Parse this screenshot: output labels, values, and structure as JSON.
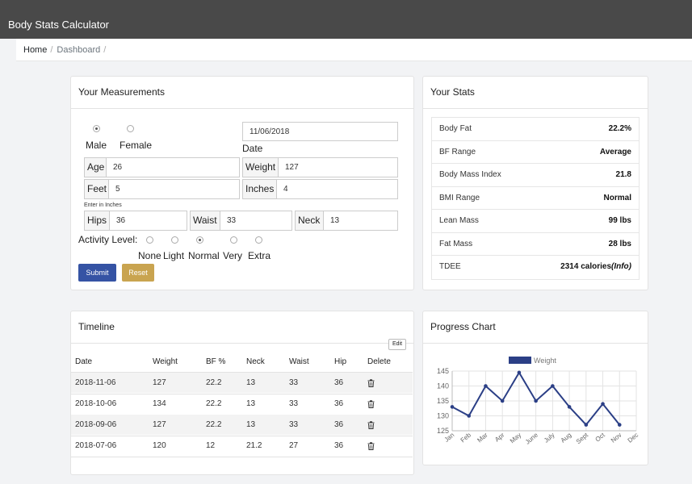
{
  "app": {
    "title": "Body Stats Calculator"
  },
  "breadcrumb": {
    "home": "Home",
    "current": "Dashboard"
  },
  "measurements": {
    "title": "Your Measurements",
    "sex": {
      "male_label": "Male",
      "female_label": "Female",
      "selected": "Male"
    },
    "date": {
      "value": "11/06/2018",
      "label": "Date"
    },
    "age": {
      "label": "Age",
      "value": "26"
    },
    "weight": {
      "label": "Weight",
      "value": "127"
    },
    "feet": {
      "label": "Feet",
      "value": "5"
    },
    "inches": {
      "label": "Inches",
      "value": "4"
    },
    "note": "Enter in Inches",
    "hips": {
      "label": "Hips",
      "value": "36"
    },
    "waist": {
      "label": "Waist",
      "value": "33"
    },
    "neck": {
      "label": "Neck",
      "value": "13"
    },
    "activity": {
      "label": "Activity Level:",
      "options": [
        "None",
        "Light",
        "Normal",
        "Very",
        "Extra"
      ],
      "selected": "Normal"
    },
    "submit_label": "Submit",
    "reset_label": "Reset"
  },
  "stats": {
    "title": "Your Stats",
    "rows": [
      {
        "key": "Body Fat",
        "value": "22.2%"
      },
      {
        "key": "BF Range",
        "value": "Average"
      },
      {
        "key": "Body Mass Index",
        "value": "21.8"
      },
      {
        "key": "BMI Range",
        "value": "Normal"
      },
      {
        "key": "Lean Mass",
        "value": "99 lbs"
      },
      {
        "key": "Fat Mass",
        "value": "28 lbs"
      },
      {
        "key": "TDEE",
        "value": "2314 calories",
        "info": "(Info)"
      }
    ]
  },
  "timeline": {
    "title": "Timeline",
    "edit_label": "Edit",
    "columns": [
      "Date",
      "Weight",
      "BF %",
      "Neck",
      "Waist",
      "Hip",
      "Delete"
    ],
    "rows": [
      [
        "2018-11-06",
        "127",
        "22.2",
        "13",
        "33",
        "36"
      ],
      [
        "2018-10-06",
        "134",
        "22.2",
        "13",
        "33",
        "36"
      ],
      [
        "2018-09-06",
        "127",
        "22.2",
        "13",
        "33",
        "36"
      ],
      [
        "2018-07-06",
        "120",
        "12",
        "21.2",
        "27",
        "36"
      ]
    ],
    "delete_icon": "trash-icon"
  },
  "progress": {
    "title": "Progress Chart"
  },
  "chart_data": {
    "type": "line",
    "categories": [
      "Jan",
      "Feb",
      "Mar",
      "Apr",
      "May",
      "June",
      "July",
      "Aug",
      "Sept",
      "Oct",
      "Nov",
      "Dec"
    ],
    "series": [
      {
        "name": "Weight",
        "values": [
          133,
          130,
          140,
          135,
          144.5,
          135,
          140,
          133,
          127,
          134,
          127,
          null
        ]
      }
    ],
    "ylim": [
      125,
      145
    ],
    "yticks": [
      125,
      130,
      135,
      140,
      145
    ],
    "grid": true,
    "legend": "top",
    "color": "#2b3f86"
  }
}
